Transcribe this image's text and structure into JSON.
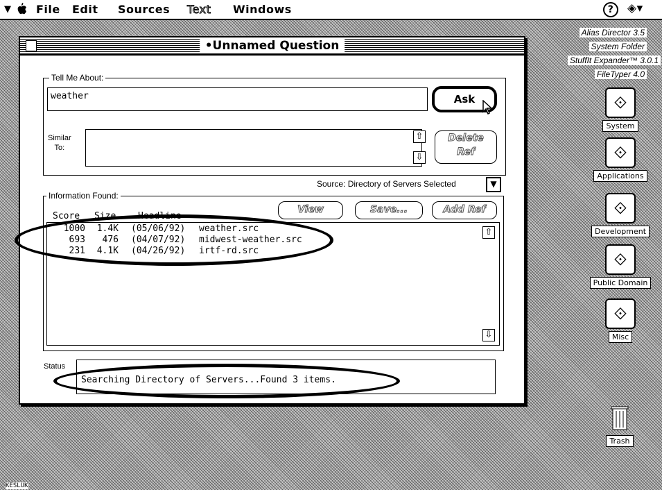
{
  "menubar": {
    "menu_icon": "▼",
    "apple_icon": "",
    "items": [
      "File",
      "Edit",
      "Sources",
      "Text",
      "Windows"
    ],
    "help_icon": "?",
    "app_icon": "◈▾"
  },
  "window": {
    "title": "•Unnamed Question",
    "tell_me_label": "Tell Me About:",
    "query": "weather",
    "ask_label": "Ask",
    "similar_label": "Similar\nTo:",
    "delete_ref_label": "Delete\nRef",
    "source_text": "Source: Directory of Servers Selected",
    "info_found_label": "Information Found:",
    "view_label": "View",
    "save_label": "Save...",
    "add_ref_label": "Add Ref",
    "headers": {
      "score": "Score",
      "size": "Size",
      "headline": "Headline"
    },
    "rows": [
      {
        "score": "1000",
        "size": "1.4K",
        "date": "(05/06/92)",
        "name": "weather.src"
      },
      {
        "score": "693",
        "size": "476",
        "date": "(04/07/92)",
        "name": "midwest-weather.src"
      },
      {
        "score": "231",
        "size": "4.1K",
        "date": "(04/26/92)",
        "name": "irtf-rd.src"
      }
    ],
    "status_label": "Status",
    "status_text": "Searching Directory of Servers...Found 3 items."
  },
  "desktop": {
    "aliases": [
      "Alias Director 3.5",
      "System Folder",
      "StuffIt Expander™ 3.0.1",
      "FileTyper 4.0"
    ],
    "folders": [
      "System",
      "Applications",
      "Development",
      "Public Domain",
      "Misc"
    ],
    "trash_label": "Trash",
    "corner_text": "KESLUK"
  }
}
